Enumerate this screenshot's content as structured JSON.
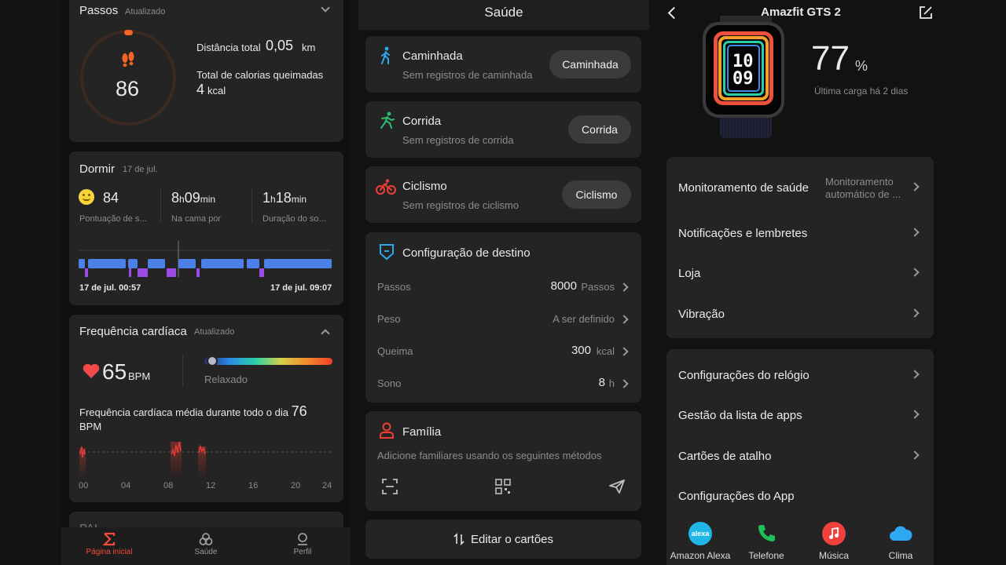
{
  "home": {
    "steps": {
      "title": "Passos",
      "status": "Atualizado",
      "count": "86",
      "distance_label": "Distância total",
      "distance_value": "0,05",
      "distance_unit": "km",
      "calories_label": "Total de calorias queimadas",
      "calories_value": "4",
      "calories_unit": "kcal"
    },
    "sleep": {
      "title": "Dormir",
      "date": "17 de jul.",
      "score": "84",
      "score_label": "Pontuação de s...",
      "bed_h": "8",
      "bed_h_unit": "h",
      "bed_m": "09",
      "bed_m_unit": "min",
      "bed_label": "Na cama por",
      "dur_h": "1",
      "dur_h_unit": "h",
      "dur_m": "18",
      "dur_m_unit": "min",
      "dur_label": "Duração do so...",
      "start": "17 de jul. 00:57",
      "end": "17 de jul. 09:07"
    },
    "heart": {
      "title": "Frequência cardíaca",
      "status": "Atualizado",
      "bpm": "65",
      "bpm_unit": "BPM",
      "zone": "Relaxado",
      "avg_text": "Frequência cardíaca média durante todo o dia",
      "avg_value": "76",
      "avg_unit": "BPM",
      "hours": [
        "00",
        "04",
        "08",
        "12",
        "16",
        "20",
        "24"
      ]
    },
    "next_card_title": "PAI",
    "nav": {
      "home": "Página inicial",
      "health": "Saúde",
      "profile": "Perfil"
    }
  },
  "health": {
    "header": "Saúde",
    "activities": [
      {
        "name": "Caminhada",
        "sub": "Sem registros de caminhada",
        "button": "Caminhada"
      },
      {
        "name": "Corrida",
        "sub": "Sem registros de corrida",
        "button": "Corrida"
      },
      {
        "name": "Ciclismo",
        "sub": "Sem registros de ciclismo",
        "button": "Ciclismo"
      }
    ],
    "goals": {
      "title": "Configuração de destino",
      "rows": [
        {
          "label": "Passos",
          "value": "8000",
          "unit": "Passos"
        },
        {
          "label": "Peso",
          "value": "A ser definido",
          "unit": ""
        },
        {
          "label": "Queima",
          "value": "300",
          "unit": "kcal"
        },
        {
          "label": "Sono",
          "value": "8",
          "unit": "h"
        }
      ]
    },
    "family": {
      "title": "Família",
      "sub": "Adicione familiares usando os seguintes métodos"
    },
    "edit_cards": "Editar o cartões"
  },
  "device": {
    "name": "Amazfit GTS 2",
    "battery": "77",
    "battery_unit": "%",
    "battery_note": "Última carga há 2 dias",
    "watch_time_h": "10",
    "watch_time_m": "09",
    "health_monitoring": "Monitoramento de saúde",
    "health_monitoring_value_1": "Monitoramento",
    "health_monitoring_value_2": "automático de ...",
    "group1": [
      "Notificações e lembretes",
      "Loja",
      "Vibração"
    ],
    "group2": [
      "Configurações do relógio",
      "Gestão da lista de apps",
      "Cartões de atalho",
      "Configurações do App"
    ],
    "apps": [
      {
        "label": "Amazon Alexa",
        "icon": "alexa-icon",
        "color": "#1fb6e8"
      },
      {
        "label": "Telefone",
        "icon": "phone-icon",
        "color": "#1fbf5a"
      },
      {
        "label": "Música",
        "icon": "music-icon",
        "color": "#f0413c"
      },
      {
        "label": "Clima",
        "icon": "cloud-icon",
        "color": "#2ea8f2"
      }
    ]
  },
  "colors": {
    "accent": "#f26522",
    "sleep_light": "#4a80e8",
    "sleep_rem": "#9b4be6",
    "heart": "#f24a4a"
  }
}
